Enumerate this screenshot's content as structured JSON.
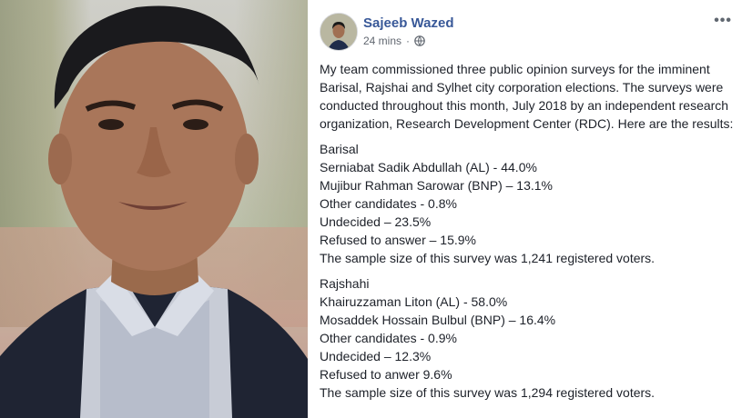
{
  "post": {
    "author": "Sajeeb Wazed",
    "time": "24 mins",
    "intro": "My team commissioned three public opinion surveys for the imminent Barisal, Rajshai and Sylhet city corporation elections. The surveys were conducted throughout this month, July 2018 by an independent research organization, Research Development Center (RDC). Here are the results:",
    "blocks": [
      {
        "title": "Barisal",
        "lines": [
          "Serniabat Sadik Abdullah (AL) - 44.0%",
          "Mujibur Rahman Sarowar (BNP) – 13.1%",
          "Other candidates - 0.8%",
          "Undecided – 23.5%",
          "Refused to answer – 15.9%",
          "The sample size of this survey was 1,241 registered voters."
        ]
      },
      {
        "title": "Rajshahi",
        "lines": [
          "Khairuzzaman Liton (AL) - 58.0%",
          "Mosaddek Hossain Bulbul (BNP) – 16.4%",
          "Other candidates - 0.9%",
          "Undecided – 12.3%",
          "Refused to anwer 9.6%",
          "The sample size of this survey was 1,294 registered voters."
        ]
      }
    ]
  },
  "icons": {
    "more": "more-options-icon",
    "privacy": "globe-icon"
  },
  "colors": {
    "author": "#385898",
    "meta": "#616770",
    "text": "#1d2129"
  }
}
